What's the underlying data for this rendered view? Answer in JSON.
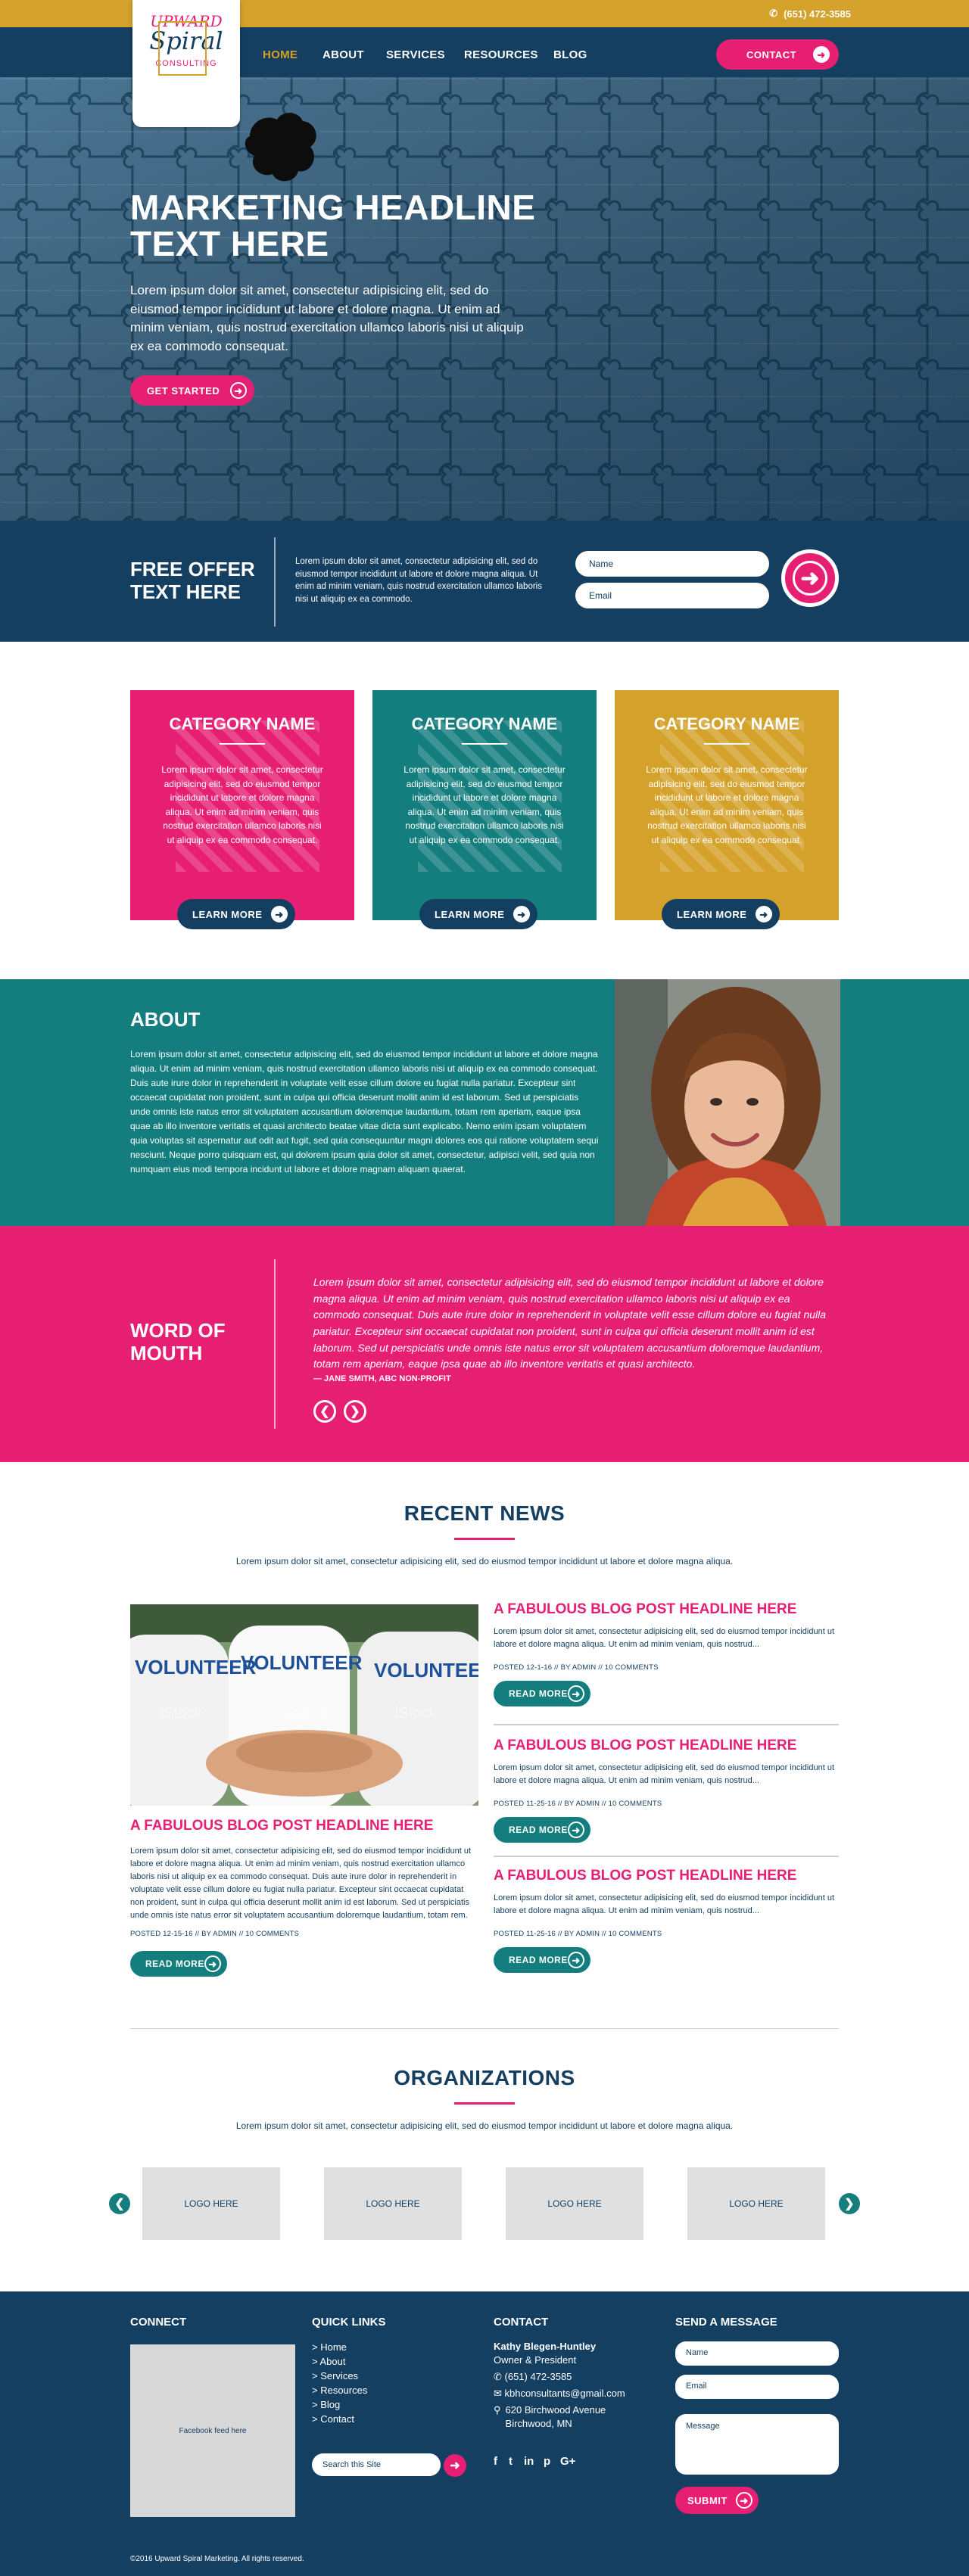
{
  "topbar": {
    "phone": "(651) 472-3585"
  },
  "logo": {
    "line1": "UPWARD",
    "line2": "Spiral",
    "line3": "CONSULTING"
  },
  "nav": {
    "items": [
      "HOME",
      "ABOUT",
      "SERVICES",
      "RESOURCES",
      "BLOG"
    ],
    "active": "HOME",
    "contact_label": "CONTACT"
  },
  "hero": {
    "headline_1": "MARKETING HEADLINE",
    "headline_2": "TEXT HERE",
    "text": "Lorem ipsum dolor sit amet, consectetur adipisicing elit, sed do eiusmod tempor incididunt ut labore et dolore magna. Ut enim ad minim veniam, quis nostrud exercitation ullamco laboris nisi ut aliquip ex ea commodo consequat.",
    "cta_label": "GET STARTED"
  },
  "offer": {
    "title_1": "FREE OFFER",
    "title_2": "TEXT HERE",
    "text": "Lorem ipsum dolor sit amet, consectetur adipisicing elit, sed do eiusmod tempor incididunt ut labore et dolore magna aliqua. Ut enim ad minim veniam, quis nostrud exercitation ullamco laboris nisi ut aliquip ex ea commodo.",
    "name_placeholder": "Name",
    "email_placeholder": "Email"
  },
  "categories": [
    {
      "title": "CATEGORY NAME",
      "text": "Lorem ipsum dolor sit amet, consectetur adipisicing elit, sed do eiusmod tempor incididunt ut labore et dolore magna aliqua. Ut enim ad minim veniam, quis nostrud exercitation ullamco laboris nisi ut aliquip ex ea commodo consequat.",
      "button": "LEARN MORE",
      "color": "#e61f73"
    },
    {
      "title": "CATEGORY NAME",
      "text": "Lorem ipsum dolor sit amet, consectetur adipisicing elit, sed do eiusmod tempor incididunt ut labore et dolore magna aliqua. Ut enim ad minim veniam, quis nostrud exercitation ullamco laboris nisi ut aliquip ex ea commodo consequat.",
      "button": "LEARN MORE",
      "color": "#147d7d"
    },
    {
      "title": "CATEGORY NAME",
      "text": "Lorem ipsum dolor sit amet, consectetur adipisicing elit, sed do eiusmod tempor incididunt ut labore et dolore magna aliqua. Ut enim ad minim veniam, quis nostrud exercitation ullamco laboris nisi ut aliquip ex ea commodo consequat.",
      "button": "LEARN MORE",
      "color": "#d4a12a"
    }
  ],
  "about": {
    "title": "ABOUT",
    "text": "Lorem ipsum dolor sit amet, consectetur adipisicing elit, sed do eiusmod tempor incididunt ut labore et dolore magna aliqua. Ut enim ad minim veniam, quis nostrud exercitation ullamco laboris nisi ut aliquip ex ea commodo consequat. Duis aute irure dolor in reprehenderit in voluptate velit esse cillum dolore eu fugiat nulla pariatur. Excepteur sint occaecat cupidatat non proident, sunt in culpa qui officia deserunt mollit anim id est laborum. Sed ut perspiciatis unde omnis iste natus error sit voluptatem accusantium doloremque laudantium, totam rem aperiam, eaque ipsa quae ab illo inventore veritatis et quasi architecto beatae vitae dicta sunt explicabo. Nemo enim ipsam voluptatem quia voluptas sit aspernatur aut odit aut fugit, sed quia consequuntur magni dolores eos qui ratione voluptatem sequi nesciunt. Neque porro quisquam est, qui dolorem ipsum quia dolor sit amet, consectetur, adipisci velit, sed quia non numquam eius modi tempora incidunt ut labore et dolore magnam aliquam quaerat."
  },
  "testimonial": {
    "title_1": "WORD OF",
    "title_2": "MOUTH",
    "quote": "Lorem ipsum dolor sit amet, consectetur adipisicing elit, sed do eiusmod tempor incididunt ut labore et dolore magna aliqua. Ut enim ad minim veniam, quis nostrud exercitation ullamco laboris nisi ut aliquip ex ea commodo consequat. Duis aute irure dolor in reprehenderit in voluptate velit esse cillum dolore eu fugiat nulla pariatur. Excepteur sint occaecat cupidatat non proident, sunt in culpa qui officia deserunt mollit anim id est laborum. Sed ut perspiciatis unde omnis iste natus error sit voluptatem accusantium doloremque laudantium, totam rem aperiam, eaque ipsa quae ab illo inventore veritatis et quasi architecto.",
    "author": "— JANE SMITH, ABC NON-PROFIT"
  },
  "news": {
    "title": "RECENT NEWS",
    "intro": "Lorem ipsum dolor sit amet, consectetur adipisicing elit, sed do eiusmod tempor incididunt ut labore et dolore magna aliqua.",
    "featured": {
      "headline": "A FABULOUS BLOG POST HEADLINE HERE",
      "text": "Lorem ipsum dolor sit amet, consectetur adipisicing elit, sed do eiusmod tempor incididunt ut labore et dolore magna aliqua. Ut enim ad minim veniam, quis nostrud exercitation ullamco laboris nisi ut aliquip ex ea commodo consequat. Duis aute irure dolor in reprehenderit in voluptate velit esse cillum dolore eu fugiat nulla pariatur. Excepteur sint occaecat cupidatat non proident, sunt in culpa qui officia deserunt mollit anim id est laborum. Sed ut perspiciatis unde omnis iste natus error sit voluptatem accusantium doloremque laudantium, totam rem.",
      "meta": "POSTED 12-15-16 // BY ADMIN // 10 COMMENTS",
      "button": "READ MORE",
      "image_words": [
        "VOLUNTEER",
        "VOLUNTEER",
        "VOLUNTEER",
        "iStock"
      ]
    },
    "posts": [
      {
        "headline": "A FABULOUS BLOG POST HEADLINE HERE",
        "text": "Lorem ipsum dolor sit amet, consectetur adipisicing elit, sed do eiusmod tempor incididunt ut labore et dolore magna aliqua. Ut enim ad minim veniam, quis nostrud...",
        "meta": "POSTED 12-1-16 // BY ADMIN // 10 COMMENTS",
        "button": "READ MORE"
      },
      {
        "headline": "A FABULOUS BLOG POST HEADLINE HERE",
        "text": "Lorem ipsum dolor sit amet, consectetur adipisicing elit, sed do eiusmod tempor incididunt ut labore et dolore magna aliqua. Ut enim ad minim veniam, quis nostrud...",
        "meta": "POSTED 11-25-16 // BY ADMIN // 10 COMMENTS",
        "button": "READ MORE"
      },
      {
        "headline": "A FABULOUS BLOG POST HEADLINE HERE",
        "text": "Lorem ipsum dolor sit amet, consectetur adipisicing elit, sed do eiusmod tempor incididunt ut labore et dolore magna aliqua. Ut enim ad minim veniam, quis nostrud...",
        "meta": "POSTED 11-25-16 // BY ADMIN // 10 COMMENTS",
        "button": "READ MORE"
      }
    ]
  },
  "orgs": {
    "title": "ORGANIZATIONS",
    "intro": "Lorem ipsum dolor sit amet, consectetur adipisicing elit, sed do eiusmod tempor incididunt ut labore et dolore magna aliqua.",
    "logos": [
      "LOGO HERE",
      "LOGO HERE",
      "LOGO HERE",
      "LOGO HERE"
    ]
  },
  "footer": {
    "connect_title": "CONNECT",
    "fb_placeholder": "Facebook feed here",
    "links_title": "QUICK LINKS",
    "links": [
      "> Home",
      "> About",
      "> Services",
      "> Resources",
      "> Blog",
      "> Contact"
    ],
    "search_placeholder": "Search this Site",
    "contact_title": "CONTACT",
    "contact_name": "Kathy Blegen-Huntley",
    "contact_role": "Owner & President",
    "contact_phone": "(651) 472-3585",
    "contact_email": "kbhconsultants@gmail.com",
    "contact_addr1": "620 Birchwood Avenue",
    "contact_addr2": "Birchwood, MN",
    "social": [
      "f",
      "t",
      "in",
      "p",
      "G+"
    ],
    "message_title": "SEND A MESSAGE",
    "msg_name": "Name",
    "msg_email": "Email",
    "msg_message": "Message",
    "submit": "SUBMIT",
    "copyright": "©2016 Upward Spiral Marketing. All rights reserved."
  },
  "colors": {
    "navy": "#143f61",
    "pink": "#e61f73",
    "teal": "#147d7d",
    "gold": "#d4a12a"
  }
}
